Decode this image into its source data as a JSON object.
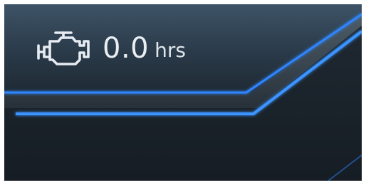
{
  "engine_hours": {
    "icon": "engine-icon",
    "value": "0.0",
    "unit": "hrs"
  },
  "colors": {
    "accent_glow": "#2f8bff",
    "text": "#e6ecf1",
    "panel_top": "#3a4f62",
    "panel_bottom": "#1a232c"
  }
}
